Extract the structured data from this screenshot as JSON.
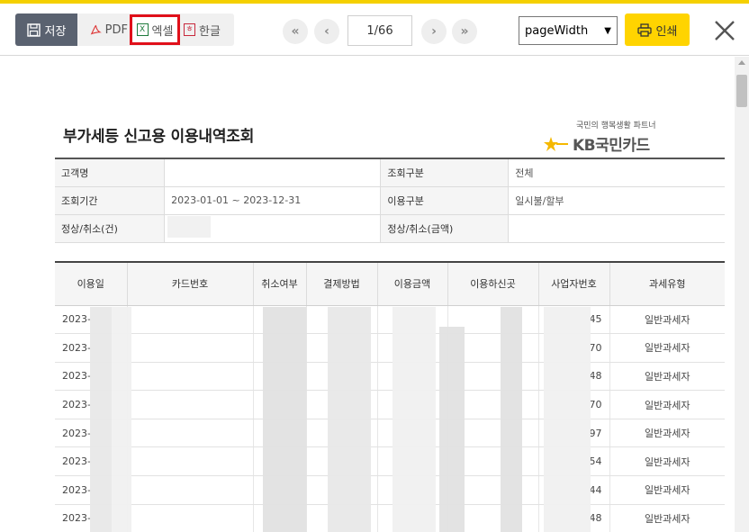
{
  "toolbar": {
    "save_label": "저장",
    "pdf_label": "PDF",
    "excel_label": "엑셀",
    "hwp_label": "한글",
    "page_indicator": "1/66",
    "zoom_value": "pageWidth",
    "print_label": "인쇄"
  },
  "document": {
    "title": "부가세등 신고용 이용내역조회",
    "brand_slogan": "국민의 행복생활 파트너",
    "brand_name": "KB국민카드",
    "info": {
      "customer_label": "고객명",
      "customer_value": "",
      "query_type_label": "조회구분",
      "query_type_value": "전체",
      "period_label": "조회기간",
      "period_value": "2023-01-01 ~ 2023-12-31",
      "usage_type_label": "이용구분",
      "usage_type_value": "일시불/할부",
      "normal_cancel_count_label": "정상/취소(건)",
      "normal_cancel_count_value": "",
      "normal_cancel_amount_label": "정상/취소(금액)",
      "normal_cancel_amount_value": ""
    },
    "columns": [
      "이용일",
      "카드번호",
      "취소여부",
      "결제방법",
      "이용금액",
      "이용하신곳",
      "사업자번호",
      "과세유형"
    ],
    "rows": [
      {
        "date": "2023-",
        "biz_suffix": "45",
        "tax_type": "일반과세자"
      },
      {
        "date": "2023-",
        "biz_suffix": "70",
        "tax_type": "일반과세자"
      },
      {
        "date": "2023-",
        "biz_suffix": "48",
        "tax_type": "일반과세자"
      },
      {
        "date": "2023-",
        "biz_suffix": "70",
        "tax_type": "일반과세자"
      },
      {
        "date": "2023-",
        "biz_suffix": "97",
        "tax_type": "일반과세자"
      },
      {
        "date": "2023-",
        "biz_suffix": "54",
        "tax_type": "일반과세자"
      },
      {
        "date": "2023-",
        "biz_suffix": "44",
        "tax_type": "일반과세자"
      },
      {
        "date": "2023-",
        "biz_suffix": "48",
        "tax_type": "일반과세자"
      }
    ]
  },
  "colors": {
    "accent_yellow": "#ffd400",
    "highlight_red": "#e0101a",
    "save_button": "#5a6270"
  }
}
